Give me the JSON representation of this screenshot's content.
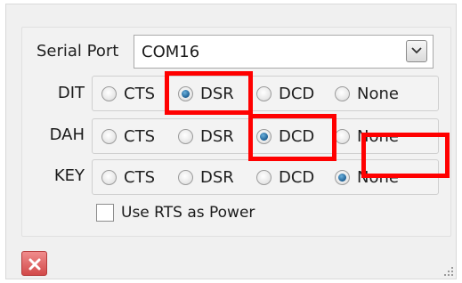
{
  "serial_port": {
    "label": "Serial Port",
    "value": "COM16"
  },
  "rows": [
    {
      "label": "DIT",
      "options": [
        "CTS",
        "DSR",
        "DCD",
        "None"
      ],
      "selected": "DSR"
    },
    {
      "label": "DAH",
      "options": [
        "CTS",
        "DSR",
        "DCD",
        "None"
      ],
      "selected": "DCD"
    },
    {
      "label": "KEY",
      "options": [
        "CTS",
        "DSR",
        "DCD",
        "None"
      ],
      "selected": "None"
    }
  ],
  "rts_power": {
    "label": "Use RTS as Power",
    "checked": false
  },
  "icons": {
    "dropdown": "chevron-down-icon",
    "close": "close-icon",
    "grip": "resize-grip-icon"
  },
  "colors": {
    "highlight": "#ff0000",
    "radio_selected": "#1d5f93",
    "close_button": "#d24a4a"
  }
}
